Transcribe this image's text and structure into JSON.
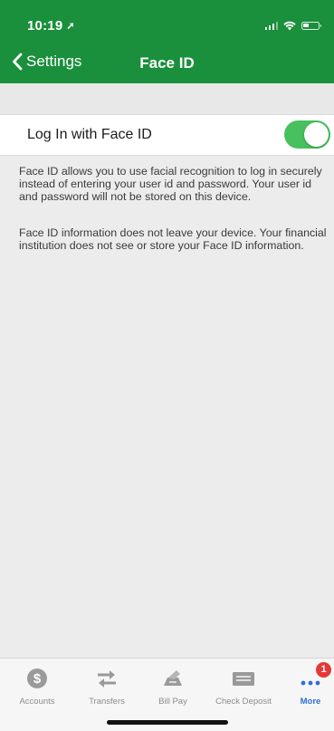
{
  "status_bar": {
    "time": "10:19",
    "battery_level": 0.35
  },
  "nav": {
    "back_label": "Settings",
    "title": "Face ID"
  },
  "setting": {
    "label": "Log In with Face ID",
    "enabled": true
  },
  "info": {
    "paragraph_1": "Face ID allows you to use facial recognition to log in securely instead of entering your user id and password. Your user id and password will not be stored on this device.",
    "paragraph_2": "Face ID information does not leave your device. Your financial institution does not see or store your Face ID information."
  },
  "tab_bar": {
    "items": [
      {
        "label": "Accounts",
        "icon": "dollar-circle-icon"
      },
      {
        "label": "Transfers",
        "icon": "transfer-arrows-icon"
      },
      {
        "label": "Bill Pay",
        "icon": "bill-pay-icon"
      },
      {
        "label": "Check Deposit",
        "icon": "check-deposit-icon"
      },
      {
        "label": "More",
        "icon": "more-dots-icon",
        "badge": "1",
        "active": true
      }
    ]
  },
  "colors": {
    "brand_green": "#1a8f3c",
    "toggle_on": "#47c05e",
    "active_tab": "#2f6fd6",
    "badge": "#e53935"
  }
}
